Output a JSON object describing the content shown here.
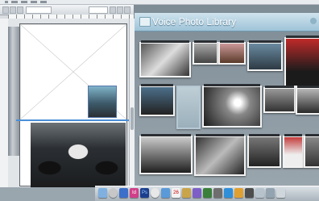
{
  "library": {
    "title": "Voice Photo Library"
  },
  "dock": {
    "calendar_day": "26",
    "app_label_ps": "Ps",
    "app_label_id": "Id"
  },
  "colors": {
    "library_header": "#b7d4e3",
    "guide": "#4a8fd8",
    "desktop": "#9aa6ae"
  }
}
